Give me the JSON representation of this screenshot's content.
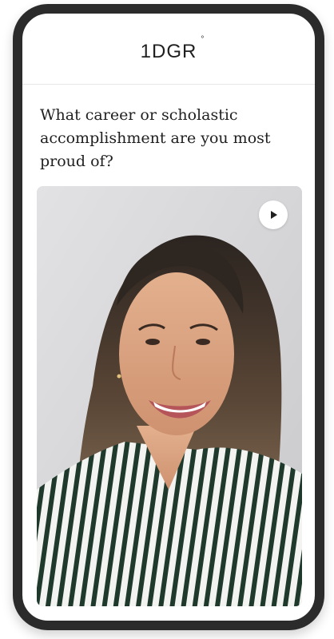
{
  "app": {
    "logo_text": "1DGR",
    "logo_mark": "°"
  },
  "prompt": {
    "question": "What career or scholastic accomplishment are you most proud of?"
  },
  "video": {
    "play_icon": "play-icon"
  }
}
